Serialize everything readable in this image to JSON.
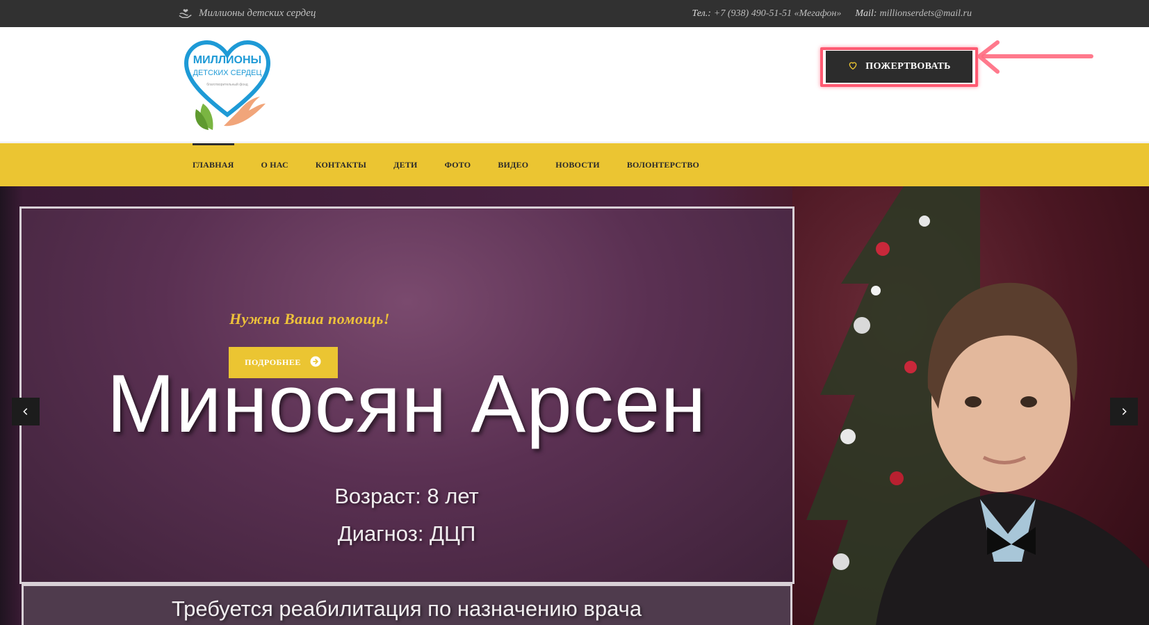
{
  "topbar": {
    "tagline": "Миллионы детских сердец",
    "phone_label": "Тел.:",
    "phone": "+7 (938) 490-51-51 «Мегафон»",
    "mail_label": "Mail:",
    "mail": "millionserdets@mail.ru"
  },
  "logo": {
    "line1": "МИЛЛИОНЫ",
    "line2": "ДЕТСКИХ СЕРДЕЦ",
    "line3": "благотворительный фонд"
  },
  "donate": {
    "label": "ПОЖЕРТВОВАТЬ"
  },
  "nav": {
    "items": [
      {
        "label": "ГЛАВНАЯ"
      },
      {
        "label": "О НАС"
      },
      {
        "label": "КОНТАКТЫ"
      },
      {
        "label": "ДЕТИ"
      },
      {
        "label": "ФОТО"
      },
      {
        "label": "ВИДЕО"
      },
      {
        "label": "НОВОСТИ"
      },
      {
        "label": "ВОЛОНТЕРСТВО"
      }
    ]
  },
  "hero": {
    "help": "Нужна Ваша помощь!",
    "more": "ПОДРОБНЕЕ",
    "name": "Миносян Арсен",
    "age": "Возраст: 8 лет",
    "diagnosis": "Диагноз: ДЦП",
    "rehab": "Требуется реабилитация по назначению врача"
  },
  "colors": {
    "topbar": "#313131",
    "nav": "#ebc532",
    "accent": "#eec23a",
    "donate_bg": "#2c2c2c",
    "highlight": "#ff5a72"
  },
  "icons": {
    "tagline": "hands-heart-icon",
    "donate": "heart-icon",
    "more": "arrow-circle-right-icon",
    "prev": "chevron-left-icon",
    "next": "chevron-right-icon"
  }
}
